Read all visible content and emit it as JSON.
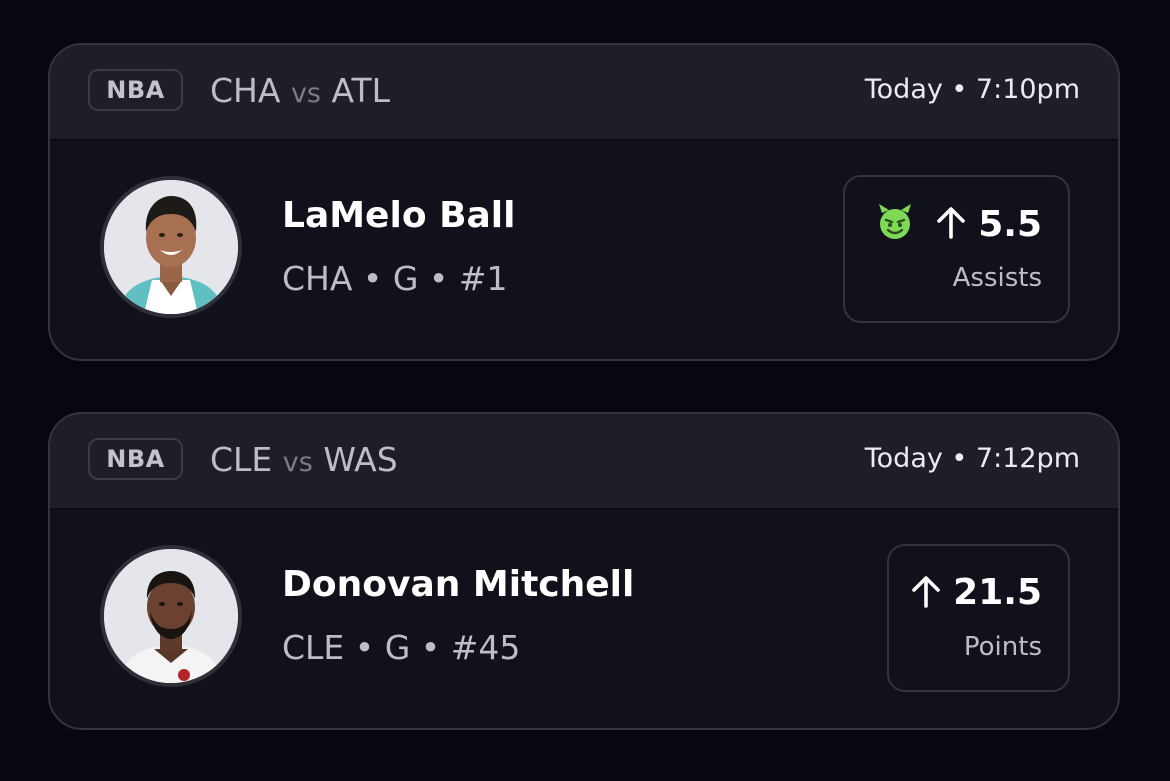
{
  "cards": [
    {
      "league": "NBA",
      "home_team": "CHA",
      "vs_label": "vs",
      "away_team": "ATL",
      "game_time": "Today • 7:10pm",
      "player": {
        "name": "LaMelo Ball",
        "info": "CHA • G • #1",
        "avatar_icon": "player-headshot"
      },
      "prop": {
        "icon": "demon-icon",
        "direction": "up-arrow-icon",
        "value": "5.5",
        "stat": "Assists"
      }
    },
    {
      "league": "NBA",
      "home_team": "CLE",
      "vs_label": "vs",
      "away_team": "WAS",
      "game_time": "Today • 7:12pm",
      "player": {
        "name": "Donovan Mitchell",
        "info": "CLE • G • #45",
        "avatar_icon": "player-headshot"
      },
      "prop": {
        "direction": "up-arrow-icon",
        "value": "21.5",
        "stat": "Points"
      }
    }
  ],
  "colors": {
    "background": "#07070f",
    "card": "#11111b",
    "card_header": "#1e1e28",
    "border": "#34343d",
    "demon_green": "#7ed957"
  }
}
